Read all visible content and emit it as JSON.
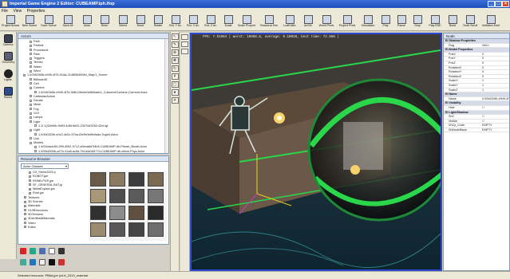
{
  "window": {
    "title": "Imperial Game Engine 2 Editor: CUBEAMP.iph.ifop",
    "minimize": "_",
    "maximize": "□",
    "close": "×"
  },
  "menu": [
    "File",
    "View",
    "Properties"
  ],
  "toolbar": [
    {
      "label": "Project Browser",
      "icon": "folder-icon"
    },
    {
      "label": "New Scene",
      "icon": "new-scene-icon"
    },
    {
      "label": "Save Scene",
      "icon": "save-icon"
    },
    {
      "label": "Save All",
      "icon": "save-all-icon"
    },
    {
      "label": "Undo",
      "icon": "undo-icon"
    },
    {
      "label": "Redo",
      "icon": "redo-icon"
    },
    {
      "label": "Select",
      "icon": "select-icon"
    },
    {
      "label": "Move",
      "icon": "move-icon"
    },
    {
      "label": "Rotate",
      "icon": "rotate-icon"
    },
    {
      "label": "Rot. Y Ax.",
      "icon": "rotate-y-icon"
    },
    {
      "label": "Rot. X Ax.",
      "icon": "rotate-x-icon"
    },
    {
      "label": "Rot. Z Ax.",
      "icon": "rotate-z-icon"
    },
    {
      "label": "Scale",
      "icon": "scale-icon"
    },
    {
      "label": "Scale Proportional",
      "icon": "scale-proportional-icon"
    },
    {
      "label": "Resource Browser",
      "icon": "resource-browser-icon"
    },
    {
      "label": "LuaEditor",
      "icon": "lua-editor-icon"
    },
    {
      "label": "dx/Cfx",
      "icon": "dx-icon"
    },
    {
      "label": "World Prefs",
      "icon": "world-prefs-icon"
    },
    {
      "label": "Project Prefs",
      "icon": "project-prefs-icon"
    },
    {
      "label": "Simulation",
      "icon": "simulation-icon"
    },
    {
      "label": "Play",
      "icon": "play-icon"
    },
    {
      "label": "Pause",
      "icon": "pause-icon"
    },
    {
      "label": "Stop",
      "icon": "stop-icon"
    },
    {
      "label": "Play EDE",
      "icon": "play-ede-icon"
    },
    {
      "label": "Build",
      "icon": "build-icon"
    },
    {
      "label": "Tools Scroll",
      "icon": "tools-icon"
    },
    {
      "label": "Imitation Mode",
      "icon": "imitation-icon"
    }
  ],
  "left_tools": [
    {
      "label": "Camera",
      "icon": "camera-icon"
    },
    {
      "label": "Geometry",
      "icon": "geometry-icon"
    },
    {
      "label": "Lights",
      "icon": "lights-icon"
    },
    {
      "label": "Sound",
      "icon": "sound-icon"
    }
  ],
  "actors_panel": {
    "title": "Actors",
    "items": [
      "Path",
      "Particle",
      "Procedural",
      "Rain",
      "Triggers",
      "Terrain",
      "Water",
      "Wind",
      "1.0/0/8/2b5b-e945-4f76-91da-21d8f3646984_Map/1_Scene",
      "BillboardS",
      "Cell",
      "Camera",
      "1.0/0/8/2b5b-e945-4f76-9bfb-D6e6e0e8b0ade4_CutsceneCamera (Camera Actor",
      "CartesianActors",
      "Decals",
      "Mesh",
      "Fog",
      "GUI",
      "Lamps",
      "Light",
      "1.1/.1(32e89b-9d93-4d5f-8e92-2337d43250.42/e.lgt",
      "Light",
      "1.0/4b0320b-e0c2-4e2c-97ba-f2e9b0e6fc9ade.3ugh4.Actor",
      "Link",
      "Models",
      "1.4/0/4da4c50-2f9f-4092-9712-a9e4a8d7f4b5-CUBEAMP-dk-Planet_Model.Actor",
      "1.0/55d/532b-a27b-41a8-ac5d-761d4d16577d-CUBEAMP-dk-cblick-Phys.Actor"
    ]
  },
  "resources_panel": {
    "title": "Resource Browser",
    "dropdown": "Actor Classes",
    "folders": [
      "G3_Stone2023.p",
      "ROBOT.jpe",
      "EMNN.PUS.jpe",
      "SF_GENERAL.BAT.jp",
      "MetalExplain.jpe",
      "Rust.jpe",
      "Textures",
      "3D Scenes",
      "Materials",
      "GUIResources",
      "3DTextures",
      "3DArtificialMaterials",
      "Video",
      "Editor"
    ],
    "actions": [
      "delete-icon",
      "add-icon",
      "folder-add-icon",
      "page-icon",
      "close-icon"
    ]
  },
  "viewport": {
    "fps_text": "FPS: 7.51984 | worst: 10996.6, average: 0.10010, best time: 72.588 |"
  },
  "properties_panel": {
    "title": "Node",
    "category_1": "El Shadow Properties",
    "rows_1": [
      {
        "k": "Flag",
        "v": "NULL"
      }
    ],
    "category_2": "El Model Properties",
    "rows_2": [
      {
        "k": "PosX",
        "v": "0"
      },
      {
        "k": "PosY",
        "v": "0"
      },
      {
        "k": "PosZ",
        "v": "0"
      },
      {
        "k": "RotationX",
        "v": "0"
      },
      {
        "k": "RotationY",
        "v": "0"
      },
      {
        "k": "RotationZ",
        "v": "0"
      },
      {
        "k": "ScaleX",
        "v": "1"
      },
      {
        "k": "ScaleY",
        "v": "1"
      },
      {
        "k": "ScaleZ",
        "v": "1"
      }
    ],
    "category_3": "El Name",
    "rows_3": [
      {
        "k": "Name",
        "v": "0.0/0d/2b5b-e945-4f76-91da-2"
      }
    ],
    "category_4": "El Visibility",
    "rows_4": [
      {
        "k": "Hide",
        "v": "☐"
      }
    ],
    "category_5": "El Light/Shadow",
    "rows_5": [
      {
        "k": "ShC",
        "v": "☐"
      },
      {
        "k": "Visible",
        "v": "☐"
      },
      {
        "k": "ShCp_Code",
        "v": "EMPTY"
      },
      {
        "k": "ShModelBase",
        "v": "EMPTY"
      }
    ]
  },
  "status": {
    "text": "Selected resource: PB6d.jpe (c/Lit_2313_material"
  },
  "colors": {
    "titlebar": "#2353c4",
    "accent_green": "#2ad64a",
    "viewport_border": "#2d4bd2"
  }
}
